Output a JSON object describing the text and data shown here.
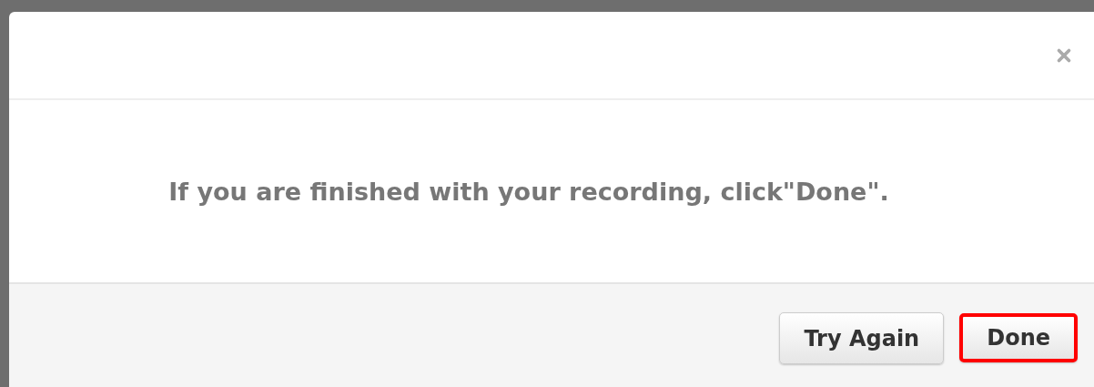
{
  "dialog": {
    "message": "If you are finished with your recording, click\"Done\".",
    "buttons": [
      {
        "label": "Try Again",
        "highlighted": false
      },
      {
        "label": "Done",
        "highlighted": true
      }
    ]
  }
}
